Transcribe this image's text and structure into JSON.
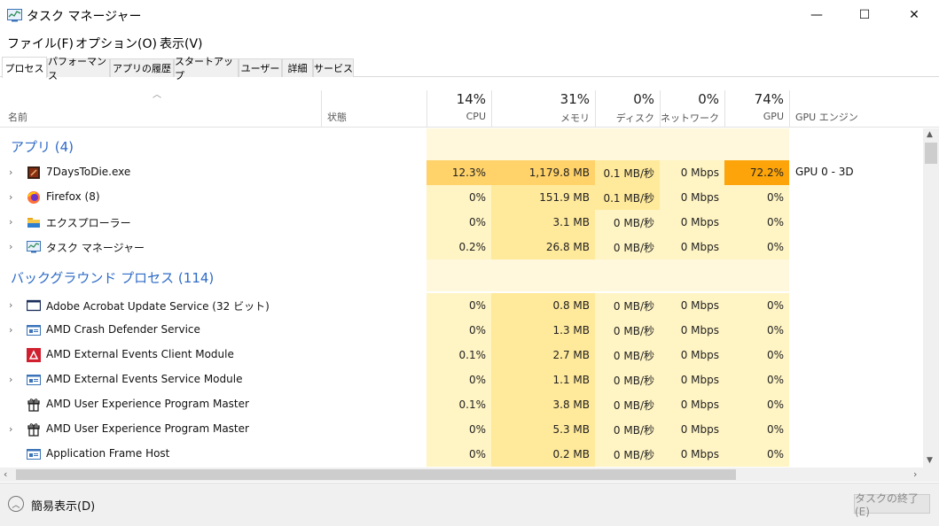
{
  "window": {
    "title": "タスク マネージャー",
    "controls": {
      "minimize": "—",
      "maximize": "☐",
      "close": "✕"
    }
  },
  "menu": [
    "ファイル(F)",
    "オプション(O)",
    "表示(V)"
  ],
  "tabs": [
    "プロセス",
    "パフォーマンス",
    "アプリの履歴",
    "スタートアップ",
    "ユーザー",
    "詳細",
    "サービス"
  ],
  "active_tab": "プロセス",
  "columns": {
    "name": "名前",
    "status": "状態",
    "cpu": {
      "pct": "14%",
      "label": "CPU"
    },
    "memory": {
      "pct": "31%",
      "label": "メモリ"
    },
    "disk": {
      "pct": "0%",
      "label": "ディスク"
    },
    "network": {
      "pct": "0%",
      "label": "ネットワーク"
    },
    "gpu": {
      "pct": "74%",
      "label": "GPU"
    },
    "gpu_engine": "GPU エンジン"
  },
  "groups": {
    "apps": "アプリ (4)",
    "background": "バックグラウンド プロセス (114)"
  },
  "apps": [
    {
      "name": "7DaysToDie.exe",
      "icon": "game-icon",
      "expandable": true,
      "cpu": "12.3%",
      "memory": "1,179.8 MB",
      "disk": "0.1 MB/秒",
      "network": "0 Mbps",
      "gpu": "72.2%",
      "gpu_engine": "GPU 0 - 3D"
    },
    {
      "name": "Firefox (8)",
      "icon": "firefox-icon",
      "expandable": true,
      "cpu": "0%",
      "memory": "151.9 MB",
      "disk": "0.1 MB/秒",
      "network": "0 Mbps",
      "gpu": "0%",
      "gpu_engine": ""
    },
    {
      "name": "エクスプローラー",
      "icon": "folder-icon",
      "expandable": true,
      "cpu": "0%",
      "memory": "3.1 MB",
      "disk": "0 MB/秒",
      "network": "0 Mbps",
      "gpu": "0%",
      "gpu_engine": ""
    },
    {
      "name": "タスク マネージャー",
      "icon": "task-manager-icon",
      "expandable": true,
      "cpu": "0.2%",
      "memory": "26.8 MB",
      "disk": "0 MB/秒",
      "network": "0 Mbps",
      "gpu": "0%",
      "gpu_engine": ""
    }
  ],
  "background": [
    {
      "name": "Adobe Acrobat Update Service (32 ビット)",
      "icon": "window-icon",
      "expandable": true,
      "cpu": "0%",
      "memory": "0.8 MB",
      "disk": "0 MB/秒",
      "network": "0 Mbps",
      "gpu": "0%"
    },
    {
      "name": "AMD Crash Defender Service",
      "icon": "service-icon",
      "expandable": true,
      "cpu": "0%",
      "memory": "1.3 MB",
      "disk": "0 MB/秒",
      "network": "0 Mbps",
      "gpu": "0%"
    },
    {
      "name": "AMD External Events Client Module",
      "icon": "amd-icon",
      "expandable": false,
      "cpu": "0.1%",
      "memory": "2.7 MB",
      "disk": "0 MB/秒",
      "network": "0 Mbps",
      "gpu": "0%"
    },
    {
      "name": "AMD External Events Service Module",
      "icon": "service-icon",
      "expandable": true,
      "cpu": "0%",
      "memory": "1.1 MB",
      "disk": "0 MB/秒",
      "network": "0 Mbps",
      "gpu": "0%"
    },
    {
      "name": "AMD User Experience Program Master",
      "icon": "gift-icon",
      "expandable": false,
      "cpu": "0.1%",
      "memory": "3.8 MB",
      "disk": "0 MB/秒",
      "network": "0 Mbps",
      "gpu": "0%"
    },
    {
      "name": "AMD User Experience Program Master",
      "icon": "gift-icon",
      "expandable": true,
      "cpu": "0%",
      "memory": "5.3 MB",
      "disk": "0 MB/秒",
      "network": "0 Mbps",
      "gpu": "0%"
    },
    {
      "name": "Application Frame Host",
      "icon": "service-icon",
      "expandable": false,
      "cpu": "0%",
      "memory": "0.2 MB",
      "disk": "0 MB/秒",
      "network": "0 Mbps",
      "gpu": "0%"
    }
  ],
  "footer": {
    "fewer_details": "簡易表示(D)",
    "end_task": "タスクの終了(E)"
  },
  "colors": {
    "heat_light": "#fff4c4",
    "heat_mid": "#ffe99b",
    "heat_hot": "#ffd26a",
    "heat_gpu_hot": "#fca40a",
    "group_title": "#2e6bc6",
    "empty_band": "#fff8dc"
  }
}
